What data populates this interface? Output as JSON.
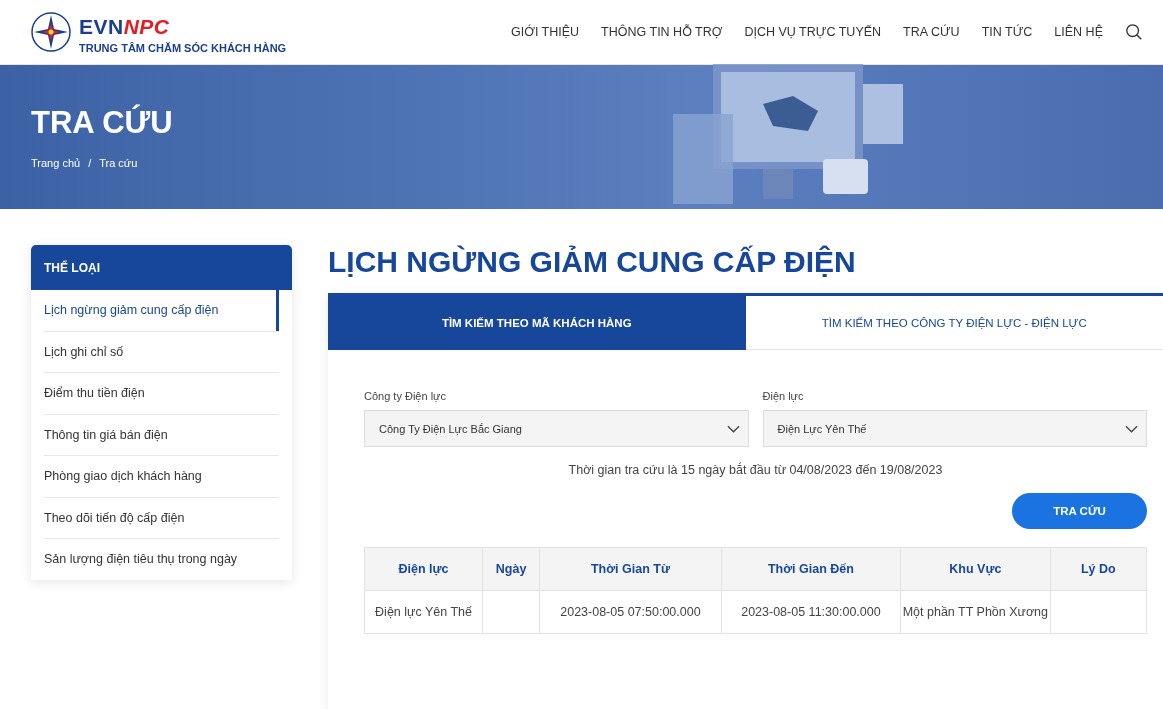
{
  "header": {
    "logo": {
      "brand_left": "EVN",
      "brand_right": "NPC",
      "subtitle": "TRUNG TÂM CHĂM SÓC KHÁCH HÀNG"
    },
    "nav": [
      {
        "label": "GIỚI THIỆU",
        "selected": false
      },
      {
        "label": "THÔNG TIN HỖ TRỢ",
        "selected": false
      },
      {
        "label": "DỊCH VỤ TRỰC TUYẾN",
        "selected": false
      },
      {
        "label": "TRA CỨU",
        "selected": false
      },
      {
        "label": "TIN TỨC",
        "selected": false
      },
      {
        "label": "LIÊN HỆ",
        "selected": false
      }
    ]
  },
  "banner": {
    "title": "TRA CỨU",
    "breadcrumb": [
      "Trang chủ",
      "/",
      "Tra cứu"
    ]
  },
  "sidebar": {
    "title": "THỂ LOẠI",
    "items": [
      {
        "label": "Lịch ngừng giảm cung cấp điện",
        "selected": true
      },
      {
        "label": "Lịch ghi chỉ số",
        "selected": false
      },
      {
        "label": "Điểm thu tiền điện",
        "selected": false
      },
      {
        "label": "Thông tin giá bán điện",
        "selected": false
      },
      {
        "label": "Phòng giao dịch khách hàng",
        "selected": false
      },
      {
        "label": "Theo dõi tiến độ cấp điện",
        "selected": false
      },
      {
        "label": "Sản lượng điện tiêu thụ trong ngày",
        "selected": false
      }
    ]
  },
  "main": {
    "title": "LỊCH NGỪNG GIẢM CUNG CẤP ĐIỆN",
    "tabs": [
      {
        "label": "TÌM KIẾM THEO MÃ KHÁCH HÀNG",
        "selected": false
      },
      {
        "label": "TÌM KIẾM THEO CÔNG TY ĐIỆN LỰC - ĐIỆN LỰC",
        "selected": true
      }
    ],
    "fields": [
      {
        "label": "Công ty Điện lực",
        "value": "Công Ty Điện Lực Bắc Giang"
      },
      {
        "label": "Điện lực",
        "value": "Điện Lực Yên Thế"
      }
    ],
    "note": "Thời gian tra cứu là 15 ngày bắt đầu từ 04/08/2023 đến 19/08/2023",
    "button": "TRA CỨU",
    "table": {
      "columns": [
        "Điện lực",
        "Ngày",
        "Thời Gian Từ",
        "Thời Gian Đến",
        "Khu Vực",
        "Lý Do"
      ],
      "rows": [
        [
          "Điện lực Yên Thế",
          "",
          "2023-08-05 07:50:00.000",
          "2023-08-05 11:30:00.000",
          "Một phần TT Phồn Xương",
          ""
        ]
      ]
    }
  }
}
